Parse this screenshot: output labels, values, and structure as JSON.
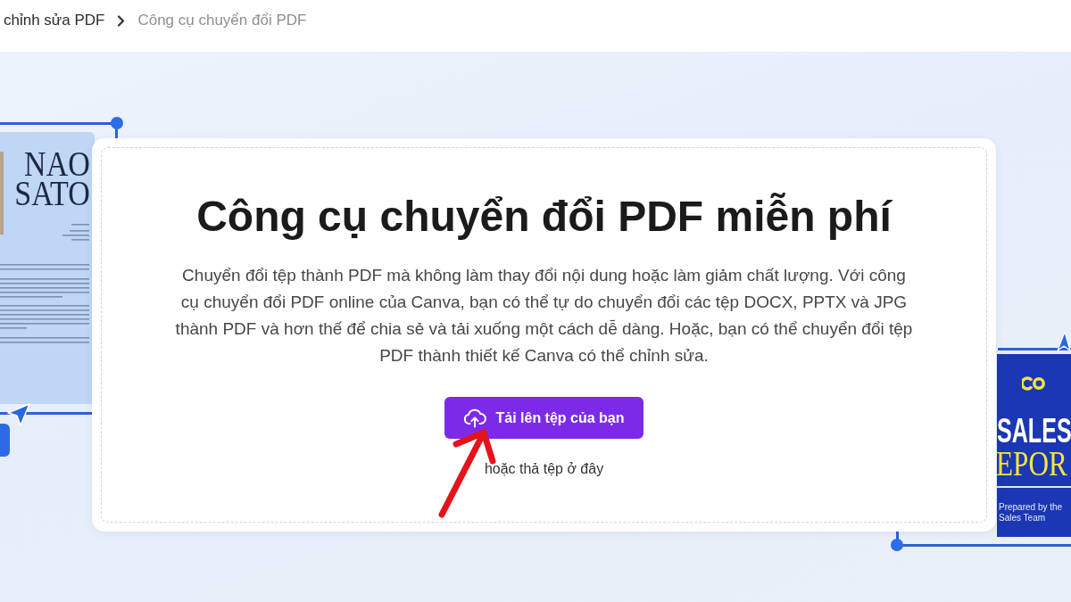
{
  "breadcrumb": {
    "items": [
      {
        "label": "chỉnh sửa PDF",
        "current": false
      },
      {
        "label": "Công cụ chuyển đổi PDF",
        "current": true
      }
    ]
  },
  "left_preview": {
    "heading_lines": [
      "NAO",
      "SATO"
    ]
  },
  "upload_card": {
    "title": "Công cụ chuyển đổi PDF miễn phí",
    "description": "Chuyển đổi tệp thành PDF mà không làm thay đổi nội dung hoặc làm giảm chất lượng. Với công cụ chuyển đổi PDF online của Canva, bạn có thể tự do chuyển đổi các tệp DOCX, PPTX và JPG thành PDF và hơn thế để chia sẻ và tải xuống một cách dễ dàng. Hoặc, bạn có thể chuyển đổi tệp PDF thành thiết kế Canva có thể chỉnh sửa.",
    "upload_button": {
      "label": "Tải lên tệp của bạn"
    },
    "drop_hint": "hoặc thả tệp ở đây"
  },
  "right_preview": {
    "title": "SALES",
    "subtitle": "EPOR",
    "caption": "Prepared by the Sales Team"
  }
}
